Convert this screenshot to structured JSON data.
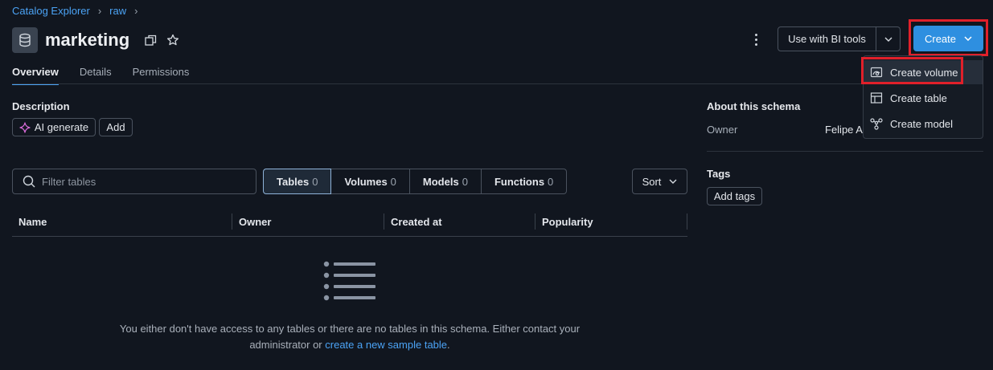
{
  "breadcrumb": {
    "items": [
      "Catalog Explorer",
      "raw"
    ],
    "separator": "›"
  },
  "header": {
    "title": "marketing"
  },
  "tabs": [
    {
      "label": "Overview",
      "active": true
    },
    {
      "label": "Details",
      "active": false
    },
    {
      "label": "Permissions",
      "active": false
    }
  ],
  "toolbar": {
    "bi_tools_label": "Use with BI tools",
    "create_label": "Create"
  },
  "create_menu": {
    "items": [
      {
        "label": "Create volume",
        "icon": "volume-icon",
        "highlighted": true
      },
      {
        "label": "Create table",
        "icon": "table-icon",
        "highlighted": false
      },
      {
        "label": "Create model",
        "icon": "model-icon",
        "highlighted": false
      }
    ]
  },
  "description": {
    "label": "Description",
    "ai_generate_label": "AI generate",
    "add_label": "Add"
  },
  "about": {
    "title": "About this schema",
    "owner_label": "Owner",
    "owner_value": "Felipe Al"
  },
  "tags": {
    "label": "Tags",
    "add_label": "Add tags"
  },
  "filter": {
    "placeholder": "Filter tables"
  },
  "segments": [
    {
      "label": "Tables",
      "count": "0",
      "active": true
    },
    {
      "label": "Volumes",
      "count": "0",
      "active": false
    },
    {
      "label": "Models",
      "count": "0",
      "active": false
    },
    {
      "label": "Functions",
      "count": "0",
      "active": false
    }
  ],
  "sort_label": "Sort",
  "table": {
    "columns": [
      "Name",
      "Owner",
      "Created at",
      "Popularity"
    ]
  },
  "empty_state": {
    "line1": "You either don't have access to any tables or there are no tables in this schema. Either contact your",
    "line2_prefix": "administrator or",
    "link": "create a new sample table",
    "line2_suffix": "."
  },
  "colors": {
    "accent": "#4ba3f5",
    "primary_button": "#2e8fe0",
    "highlight_box": "#e0202a",
    "background": "#11161f"
  }
}
